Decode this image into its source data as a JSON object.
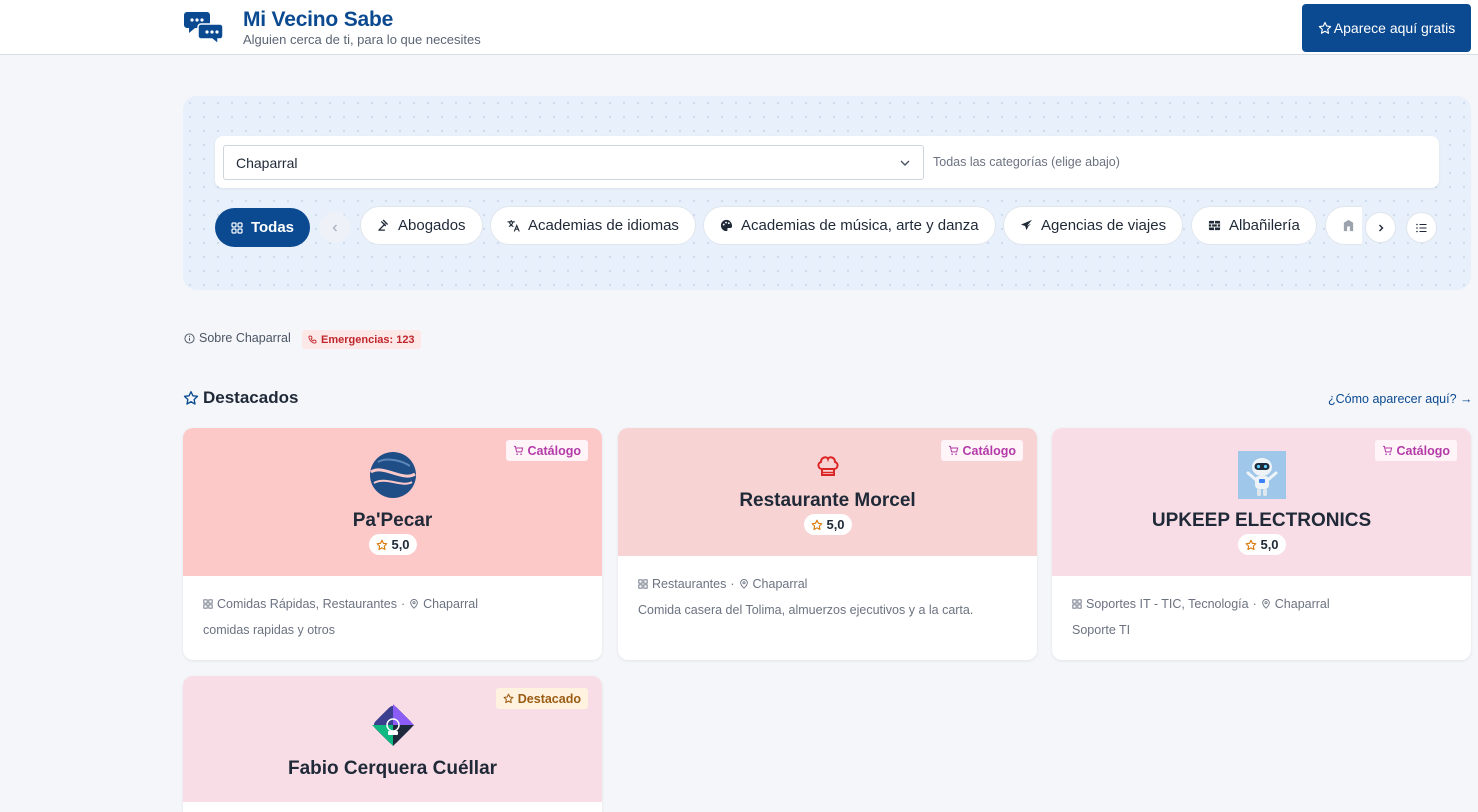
{
  "header": {
    "title": "Mi Vecino Sabe",
    "subtitle": "Alguien cerca de ti, para lo que necesites",
    "cta_label": "Aparece aquí gratis"
  },
  "search": {
    "location_value": "Chaparral",
    "category_placeholder": "Todas las categorías (elige abajo)"
  },
  "categories": {
    "all_label": "Todas",
    "items": [
      {
        "label": "Abogados",
        "icon": "gavel-icon"
      },
      {
        "label": "Academias de idiomas",
        "icon": "translate-icon"
      },
      {
        "label": "Academias de música, arte y danza",
        "icon": "palette-icon"
      },
      {
        "label": "Agencias de viajes",
        "icon": "plane-icon"
      },
      {
        "label": "Albañilería",
        "icon": "bricks-icon"
      },
      {
        "label": "",
        "icon": "building-icon"
      }
    ]
  },
  "info": {
    "about_label": "Sobre Chaparral",
    "emergency_label": "Emergencias: 123"
  },
  "featured": {
    "title": "Destacados",
    "how_link": "¿Cómo aparecer aquí? →",
    "cards": [
      {
        "name": "Pa'Pecar",
        "badge": "Catálogo",
        "rating": "5,0",
        "categories": "Comidas Rápidas, Restaurantes",
        "location": "Chaparral",
        "description": "comidas rapidas y otros",
        "bg": "#fcc8c8"
      },
      {
        "name": "Restaurante Morcel",
        "badge": "Catálogo",
        "rating": "5,0",
        "categories": "Restaurantes",
        "location": "Chaparral",
        "description": "Comida casera del Tolima, almuerzos ejecutivos y a la carta.",
        "bg": "#f7d3d3"
      },
      {
        "name": "UPKEEP ELECTRONICS",
        "badge": "Catálogo",
        "rating": "5,0",
        "categories": "Soportes IT - TIC, Tecnología",
        "location": "Chaparral",
        "description": "Soporte TI",
        "bg": "#f8dde6"
      },
      {
        "name": "Fabio Cerquera Cuéllar",
        "badge": "Destacado",
        "bg": "#f8dde6"
      }
    ]
  },
  "colors": {
    "brand": "#0b4a91",
    "page_bg": "#f4f6fa",
    "emergency": "#c0262d",
    "catalog_badge": "#b33aa8",
    "featured_badge": "#9a5b12"
  }
}
